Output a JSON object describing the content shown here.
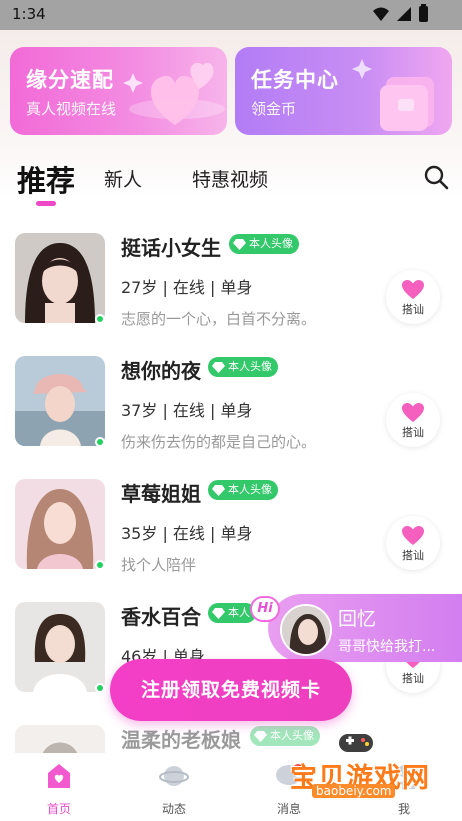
{
  "status_bar": {
    "time": "1:34"
  },
  "banners": [
    {
      "title": "缘分速配",
      "subtitle": "真人视频在线"
    },
    {
      "title": "任务中心",
      "subtitle": "领金币"
    }
  ],
  "tabs": [
    {
      "label": "推荐",
      "active": true
    },
    {
      "label": "新人",
      "active": false
    },
    {
      "label": "特惠视频",
      "active": false
    }
  ],
  "users": [
    {
      "name": "挺话小女生",
      "badge": "本人头像",
      "meta": "27岁 | 在线 | 单身",
      "motto": "志愿的一个心，白首不分离。",
      "action": "搭讪"
    },
    {
      "name": "想你的夜",
      "badge": "本人头像",
      "meta": "37岁 | 在线 | 单身",
      "motto": "伤来伤去伤的都是自己的心。",
      "action": "搭讪"
    },
    {
      "name": "草莓姐姐",
      "badge": "本人头像",
      "meta": "35岁 | 在线 | 单身",
      "motto": "找个人陪伴",
      "action": "搭讪"
    },
    {
      "name": "香水百合",
      "badge": "本人",
      "meta": "46岁 | 单身",
      "motto": "",
      "action": "搭讪"
    },
    {
      "name": "温柔的老板娘",
      "badge": "本人头像",
      "meta": "",
      "motto": "",
      "action": ""
    }
  ],
  "popup": {
    "hi": "Hi",
    "title": "回忆",
    "message": "哥哥快给我打..."
  },
  "cta": {
    "label": "注册领取免费视频卡"
  },
  "bottom_nav": [
    {
      "label": "首页",
      "active": true
    },
    {
      "label": "动态",
      "active": false
    },
    {
      "label": "消息",
      "active": false
    },
    {
      "label": "我",
      "active": false
    }
  ],
  "watermark": {
    "text": "宝贝游戏网",
    "url": "baobeiy.com"
  },
  "colors": {
    "accent": "#ee48c8",
    "online": "#23d160",
    "badge": "#33c86a"
  }
}
